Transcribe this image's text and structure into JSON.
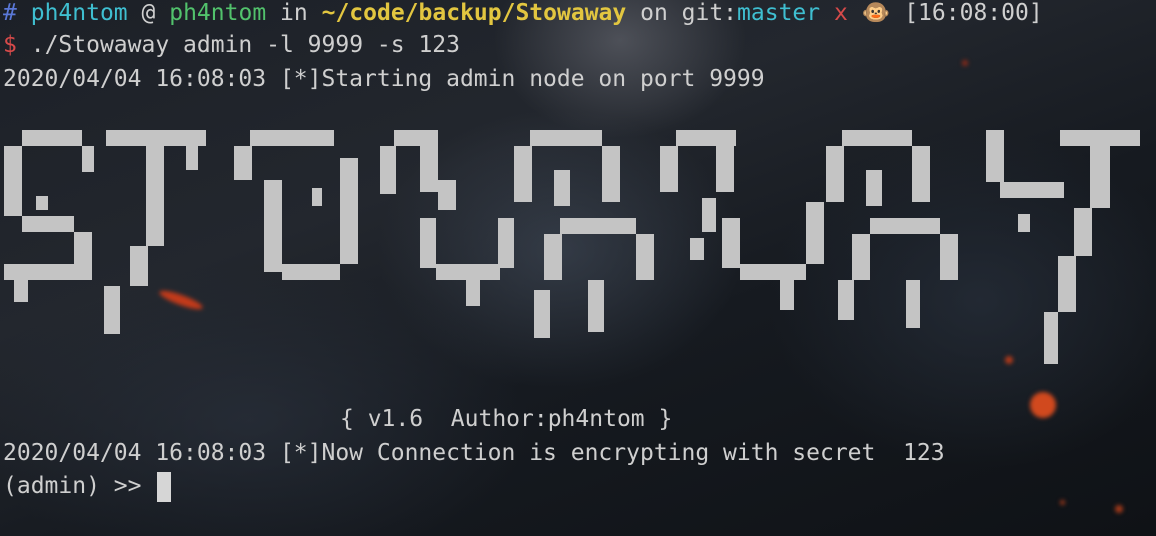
{
  "prompt": {
    "hash": "#",
    "user": "ph4ntom",
    "at": "@",
    "host": "ph4ntom",
    "in": "in",
    "path": "~/code/backup/Stowaway",
    "on_git": "on git:",
    "branch": "master",
    "dirty_mark": "x",
    "emoji": "🐵",
    "time": "[16:08:00]"
  },
  "command": {
    "symbol": "$",
    "text": "./Stowaway admin -l 9999 -s 123"
  },
  "output": {
    "start_line": "2020/04/04 16:08:03 [*]Starting admin node on port 9999",
    "version_line": "{ v1.6  Author:ph4ntom }",
    "encrypt_line": "2020/04/04 16:08:03 [*]Now Connection is encrypting with secret  123",
    "admin_prompt": "(admin) >> "
  },
  "banner": {
    "art_name": "stowaway-ascii-logo"
  },
  "colors": {
    "hash": "#5a78d8",
    "user": "#3fbfd1",
    "host": "#52c26c",
    "path": "#e2c640",
    "branch": "#3fbfd1",
    "dirty": "#d64a4a",
    "prompt_symbol": "#d64a4a",
    "text": "#d2d2d2",
    "banner": "#c4c4c4"
  }
}
